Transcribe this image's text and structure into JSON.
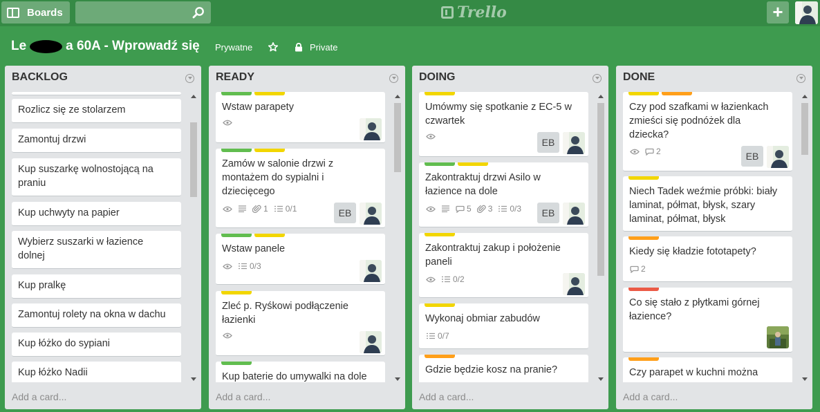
{
  "header": {
    "boards_label": "Boards",
    "search_value": "",
    "logo_text": "Trello",
    "add_label": "+"
  },
  "board": {
    "title": "Le   a 60A - Wprowadź się",
    "visibility_pl": "Prywatne",
    "visibility": "Private"
  },
  "colors": {
    "green": "#61bd4f",
    "yellow": "#f2d600",
    "orange": "#ff9f1a",
    "red": "#eb5a46"
  },
  "lists": [
    {
      "name": "BACKLOG",
      "add_card": "Add a card...",
      "cards": [
        {
          "title": "Rozlicz się ze stolarzem"
        },
        {
          "title": "Zamontuj drzwi"
        },
        {
          "title": "Kup suszarkę wolnostojącą na praniu"
        },
        {
          "title": "Kup uchwyty na papier"
        },
        {
          "title": "Wybierz suszarki w łazience dolnej"
        },
        {
          "title": "Kup pralkę"
        },
        {
          "title": "Zamontuj rolety na okna w dachu"
        },
        {
          "title": "Kup łóżko do sypiani"
        },
        {
          "title": "Kup łóżko Nadii"
        }
      ]
    },
    {
      "name": "READY",
      "add_card": "Add a card...",
      "cards": [
        {
          "title": "Wstaw parapety",
          "labels": [
            "green",
            "yellow"
          ]
        },
        {
          "title": "Zamów w salonie drzwi z montażem do sypialni i dziecięcego",
          "labels": [
            "green",
            "yellow"
          ],
          "attachments": "1",
          "checklist": "0/1",
          "member": "EB"
        },
        {
          "title": "Wstaw panele",
          "labels": [
            "green",
            "yellow"
          ],
          "checklist": "0/3"
        },
        {
          "title": "Zleć p. Ryśkowi podłączenie łazienki",
          "labels": [
            "yellow"
          ]
        },
        {
          "title": "Kup baterie do umywalki na dole",
          "labels": [
            "green"
          ]
        }
      ]
    },
    {
      "name": "DOING",
      "add_card": "Add a card...",
      "cards": [
        {
          "title": "Umówmy się spotkanie z EC-5 w czwartek",
          "labels": [
            "yellow"
          ],
          "member": "EB"
        },
        {
          "title": "Zakontraktuj drzwi Asilo w łazience na dole",
          "labels": [
            "green",
            "yellow"
          ],
          "comments": "5",
          "attachments": "3",
          "checklist": "0/3",
          "member": "EB"
        },
        {
          "title": "Zakontraktuj zakup i położenie paneli",
          "labels": [
            "yellow"
          ],
          "checklist": "0/2"
        },
        {
          "title": "Wykonaj obmiar zabudów",
          "labels": [
            "yellow"
          ],
          "checklist": "0/7"
        },
        {
          "title": "Gdzie będzie kosz na pranie?",
          "labels": [
            "orange"
          ]
        }
      ]
    },
    {
      "name": "DONE",
      "add_card": "Add a card...",
      "cards": [
        {
          "title": "Czy pod szafkami w łazienkach zmieści się podnóżek dla dziecka?",
          "labels": [
            "yellow",
            "orange"
          ],
          "comments": "2",
          "member": "EB"
        },
        {
          "title": "Niech Tadek weźmie próbki: biały laminat, półmat, błysk, szary laminat, półmat, błysk",
          "labels": [
            "yellow"
          ]
        },
        {
          "title": "Kiedy się kładzie fototapety?",
          "labels": [
            "orange"
          ],
          "comments": "2"
        },
        {
          "title": "Co się stało z płytkami górnej łazience?",
          "labels": [
            "red"
          ]
        },
        {
          "title": "Czy parapet w kuchni można",
          "labels": [
            "orange"
          ]
        }
      ]
    }
  ]
}
